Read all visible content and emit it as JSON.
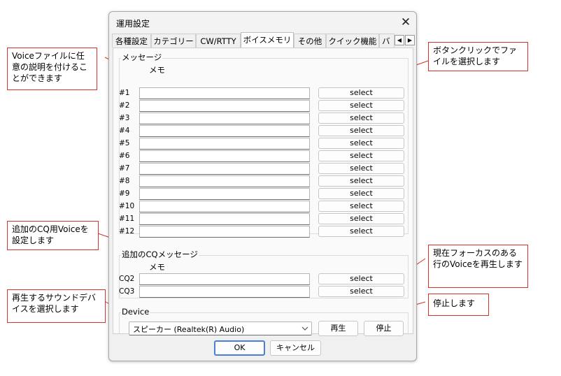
{
  "dialog": {
    "title": "運用設定"
  },
  "tabs": [
    "各種設定",
    "カテゴリー",
    "CW/RTTY",
    "ボイスメモリ",
    "その他",
    "クイック機能",
    "バ"
  ],
  "active_tab": "ボイスメモリ",
  "message_group": {
    "legend": "メッセージ",
    "memo_header": "メモ",
    "rows": [
      {
        "label": "#1",
        "memo": "",
        "button": "select"
      },
      {
        "label": "#2",
        "memo": "",
        "button": "select"
      },
      {
        "label": "#3",
        "memo": "",
        "button": "select"
      },
      {
        "label": "#4",
        "memo": "",
        "button": "select"
      },
      {
        "label": "#5",
        "memo": "",
        "button": "select"
      },
      {
        "label": "#6",
        "memo": "",
        "button": "select"
      },
      {
        "label": "#7",
        "memo": "",
        "button": "select"
      },
      {
        "label": "#8",
        "memo": "",
        "button": "select"
      },
      {
        "label": "#9",
        "memo": "",
        "button": "select"
      },
      {
        "label": "#10",
        "memo": "",
        "button": "select"
      },
      {
        "label": "#11",
        "memo": "",
        "button": "select"
      },
      {
        "label": "#12",
        "memo": "",
        "button": "select"
      }
    ]
  },
  "cq_group": {
    "legend": "追加のCQメッセージ",
    "memo_header": "メモ",
    "rows": [
      {
        "label": "CQ2",
        "memo": "",
        "button": "select"
      },
      {
        "label": "CQ3",
        "memo": "",
        "button": "select"
      }
    ]
  },
  "device": {
    "legend": "Device",
    "selected": "スピーカー (Realtek(R) Audio)",
    "play_label": "再生",
    "stop_label": "停止"
  },
  "footer": {
    "ok_label": "OK",
    "cancel_label": "キャンセル"
  },
  "callouts": {
    "voice_memo": "Voiceファイルに任意の説明を付けることができます",
    "button_click": "ボタンクリックでファイルを選択します",
    "cq_voice": "追加のCQ用Voiceを設定します",
    "sound_device": "再生するサウンドデバイスを選択します",
    "play_focus": "現在フォーカスのある行のVoiceを再生します",
    "stop": "停止します"
  },
  "colors": {
    "callout_border": "#d9312b",
    "dialog_bg": "#f0f0f0",
    "panel_bg": "#fafafa"
  }
}
